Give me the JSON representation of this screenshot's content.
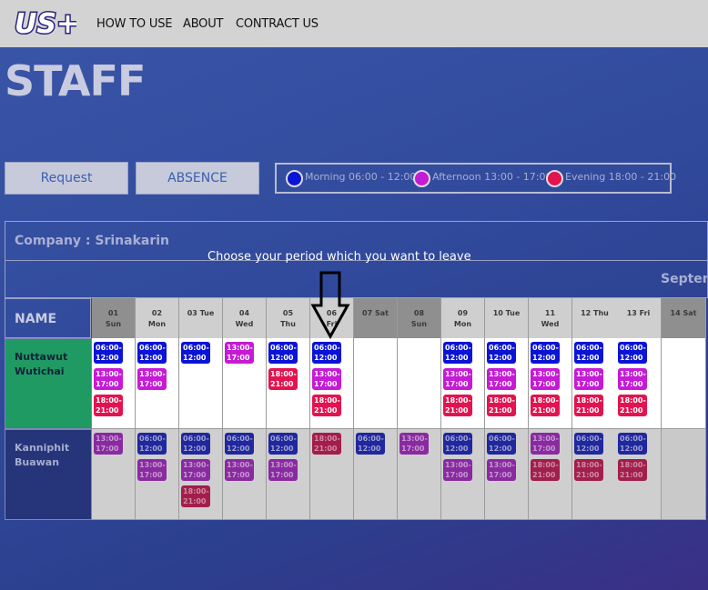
{
  "header": {
    "logo_text": "US+",
    "nav": [
      "HOW TO USE",
      "ABOUT",
      "CONTRACT US"
    ]
  },
  "page_title": "STAFF",
  "buttons": {
    "request": "Request",
    "absence": "ABSENCE"
  },
  "legend": [
    {
      "label": "Morning 06:00 - 12:00",
      "color": "#0b14d6"
    },
    {
      "label": "Afternoon 13:00 - 17:00",
      "color": "#c61ad6"
    },
    {
      "label": "Evening 18:00 - 21:00",
      "color": "#e3134f"
    }
  ],
  "schedule": {
    "company": "Company : Srinakarin",
    "month": "Septem",
    "instruction": "Choose your period which you want to leave",
    "name_header": "NAME",
    "days": [
      {
        "num": "01",
        "dow": "Sun"
      },
      {
        "num": "02",
        "dow": "Mon"
      },
      {
        "num": "03 Tue",
        "dow": ""
      },
      {
        "num": "04",
        "dow": "Wed"
      },
      {
        "num": "05",
        "dow": "Thu"
      },
      {
        "num": "06",
        "dow": "Fri"
      },
      {
        "num": "07 Sat",
        "dow": ""
      },
      {
        "num": "08",
        "dow": "Sun"
      },
      {
        "num": "09",
        "dow": "Mon"
      },
      {
        "num": "10 Tue",
        "dow": ""
      },
      {
        "num": "11",
        "dow": "Wed"
      },
      {
        "num": "12 Thu",
        "dow": ""
      },
      {
        "num": "13 Fri",
        "dow": ""
      },
      {
        "num": "14 Sat",
        "dow": ""
      }
    ],
    "staff": [
      {
        "first": "Nuttawut",
        "last": "Wutichai",
        "color": "#1f9a63",
        "shifts": [
          [
            "m",
            "a",
            "e"
          ],
          [
            "m",
            "a"
          ],
          [
            "m"
          ],
          [
            "a"
          ],
          [
            "m",
            "e"
          ],
          [
            "m",
            "a",
            "e"
          ],
          [],
          [],
          [
            "m",
            "a",
            "e"
          ],
          [
            "m",
            "a",
            "e"
          ],
          [
            "m",
            "a",
            "e"
          ],
          [
            "m",
            "a",
            "e"
          ],
          [
            "m",
            "a",
            "e"
          ],
          []
        ]
      },
      {
        "first": "Kanniphit",
        "last": "Buawan",
        "color": "#26357a",
        "shifts": [
          [
            "a"
          ],
          [
            "m",
            "a"
          ],
          [
            "m",
            "a",
            "e"
          ],
          [
            "m",
            "a"
          ],
          [
            "m",
            "a"
          ],
          [
            "e"
          ],
          [
            "m"
          ],
          [
            "a"
          ],
          [
            "m",
            "a"
          ],
          [
            "m",
            "a"
          ],
          [
            "a",
            "e"
          ],
          [
            "m",
            "e"
          ],
          [
            "m",
            "e"
          ],
          []
        ]
      }
    ],
    "shift_labels": {
      "m": [
        "06:00-",
        "12:00"
      ],
      "a": [
        "13:00-",
        "17:00"
      ],
      "e": [
        "18:00-",
        "21:00"
      ]
    }
  }
}
